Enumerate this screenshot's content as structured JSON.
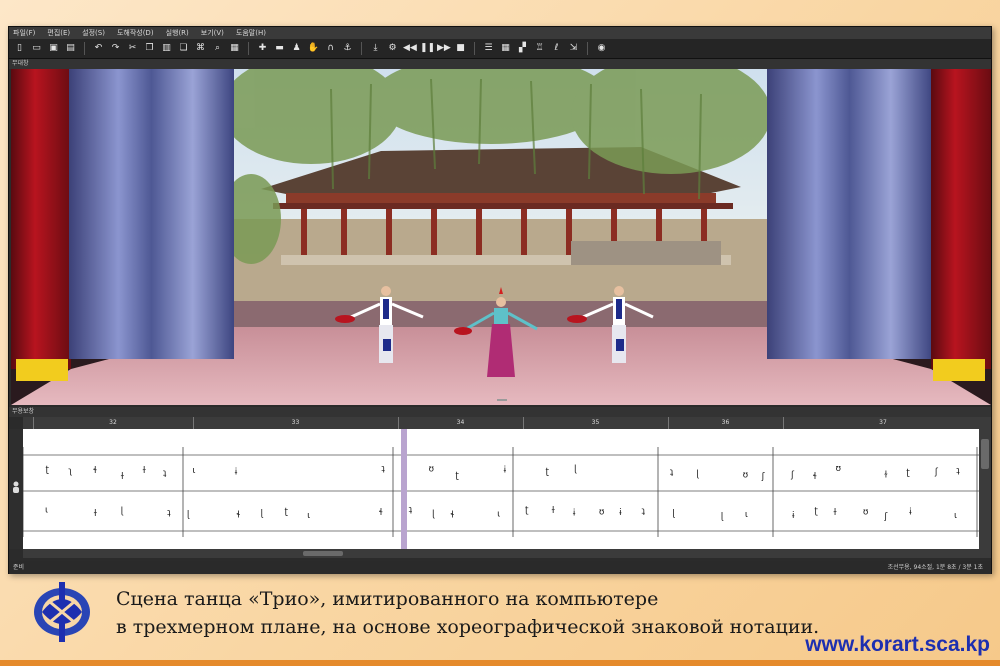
{
  "menu": [
    "파일(F)",
    "편집(E)",
    "설정(S)",
    "도해작성(D)",
    "실행(R)",
    "보기(V)",
    "도움말(H)"
  ],
  "toolbar_icons": [
    {
      "name": "new-file-icon",
      "glyph": "▯"
    },
    {
      "name": "open-folder-icon",
      "glyph": "▭"
    },
    {
      "name": "save-icon",
      "glyph": "▣"
    },
    {
      "name": "save-all-icon",
      "glyph": "▤"
    },
    {
      "sep": true
    },
    {
      "name": "undo-icon",
      "glyph": "↶"
    },
    {
      "name": "redo-icon",
      "glyph": "↷"
    },
    {
      "name": "cut-icon",
      "glyph": "✂"
    },
    {
      "name": "copy-icon",
      "glyph": "❐"
    },
    {
      "name": "paste-icon",
      "glyph": "▥"
    },
    {
      "name": "copy-frame-icon",
      "glyph": "❏"
    },
    {
      "name": "transform-icon",
      "glyph": "⌘"
    },
    {
      "name": "find-icon",
      "glyph": "⌕"
    },
    {
      "name": "calendar-icon",
      "glyph": "▦"
    },
    {
      "sep": true
    },
    {
      "name": "pose-icon",
      "glyph": "✚"
    },
    {
      "name": "film-icon",
      "glyph": "▬"
    },
    {
      "name": "figure-icon",
      "glyph": "♟"
    },
    {
      "name": "hand-icon",
      "glyph": "✋"
    },
    {
      "name": "headphones-icon",
      "glyph": "∩"
    },
    {
      "name": "anchor-icon",
      "glyph": "⚓"
    },
    {
      "sep": true
    },
    {
      "name": "import-icon",
      "glyph": "⤓"
    },
    {
      "name": "settings-icon",
      "glyph": "⚙"
    },
    {
      "name": "rewind-icon",
      "glyph": "◀◀"
    },
    {
      "name": "pause-icon",
      "glyph": "❚❚"
    },
    {
      "name": "forward-icon",
      "glyph": "▶▶"
    },
    {
      "name": "stop-icon",
      "glyph": "■"
    },
    {
      "sep": true
    },
    {
      "name": "list-icon",
      "glyph": "☰"
    },
    {
      "name": "grid-icon",
      "glyph": "▦"
    },
    {
      "name": "stage-icon",
      "glyph": "▞"
    },
    {
      "name": "dancer-icon",
      "glyph": "♖"
    },
    {
      "name": "notation-icon",
      "glyph": "ℓ"
    },
    {
      "name": "export-icon",
      "glyph": "⇲"
    },
    {
      "sep": true
    },
    {
      "name": "camera-icon",
      "glyph": "◉"
    }
  ],
  "stage_panel_title": "무대창",
  "notation_panel_title": "무용보창",
  "measures": [
    "32",
    "33",
    "34",
    "35",
    "36",
    "37"
  ],
  "status": {
    "left": "준비",
    "right": "조선무용, 94소절, 1분 8초 / 3분 1초"
  },
  "caption_line1": "Сцена танца «Трио», имитированного на компьютере",
  "caption_line2": "в трехмерном плане, на основе хореографической знаковой нотации.",
  "website": "www.korart.sca.kp",
  "colors": {
    "curtain_red": "#a8121c",
    "curtain_blue": "#5b67a8",
    "floor_pink": "#d9a6ae",
    "accent_blue": "#1d2fb0"
  }
}
